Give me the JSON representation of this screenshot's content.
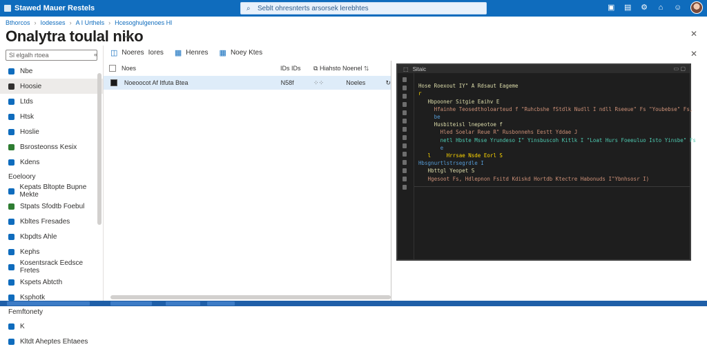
{
  "topbar": {
    "title": "Stawed Mauer Restels",
    "search_text": "Seblt ohresnterts arsorsek lerebhtes",
    "icons": [
      "cloud-shell-icon",
      "notifications-icon",
      "settings-icon",
      "help-icon",
      "feedback-icon"
    ]
  },
  "breadcrumb": [
    "Bthorcos",
    "Iodesses",
    "A I Urthels",
    "Hcesoghulgenoes Hl"
  ],
  "page": {
    "title": "Onalytra toulal niko"
  },
  "leftnav": {
    "filter_placeholder": "Sl elgalh rtoea",
    "items": [
      {
        "label": "Nbe",
        "color": "#0f6cbd"
      },
      {
        "label": "Hoosie",
        "color": "#323130",
        "active": true
      },
      {
        "label": "Ltds",
        "color": "#0f6cbd"
      },
      {
        "label": "Htsk",
        "color": "#0f6cbd"
      },
      {
        "label": "Hoslie",
        "color": "#0f6cbd"
      },
      {
        "label": "Bsrosteonss Kesix",
        "color": "#2e7d32"
      },
      {
        "label": "Kdens",
        "color": "#0f6cbd"
      }
    ],
    "group1": "Eoeloory",
    "items2": [
      {
        "label": "Kepats Bltopte Bupne Mekte",
        "color": "#0f6cbd"
      },
      {
        "label": "Stpats Sfodtb Foebul",
        "color": "#2e7d32"
      },
      {
        "label": "Kbltes Fresades",
        "color": "#0f6cbd"
      },
      {
        "label": "Kbpdts Ahle",
        "color": "#0f6cbd"
      },
      {
        "label": "Kephs",
        "color": "#0f6cbd"
      },
      {
        "label": "Kosentsrack Eedsce Fretes",
        "color": "#0f6cbd"
      },
      {
        "label": "Kspets Abtcth",
        "color": "#0f6cbd"
      },
      {
        "label": "Ksphotk",
        "color": "#0f6cbd"
      }
    ],
    "group2": "Femftonety",
    "items3": [
      {
        "label": "K",
        "color": "#0f6cbd"
      },
      {
        "label": "Kltdt Aheptes Ehtaees",
        "color": "#0f6cbd"
      }
    ]
  },
  "toolbar": {
    "new_label": "Noeres",
    "refresh_label": "Iores",
    "refresh2_label": "Henres",
    "open_label": "Noey Ktes"
  },
  "querylist": {
    "header": {
      "name": "Noes",
      "c2": "IDs",
      "c3": "IDs",
      "c4": "Hiahsto",
      "c5": "Noenel"
    },
    "row": {
      "name": "Noeoocot Af Itfuta Btea",
      "c2": "N58f",
      "c3": "⁘⁘",
      "c4": "Noeles"
    }
  },
  "editor": {
    "title": "Sitaic",
    "lines": [
      "Hose Roexout IY\" A Rdsaut Eageme",
      "r",
      "",
      "   Hbpooner Sitgie Eaihv E",
      "     Hfainhe Teosedtholoarteud f \"Ruhcbshe fStdlk Nudll I ndll Rseeue\" Fs \"Youbebse\" Fs,",
      "     be",
      "     Husbiteisl lnepeotoe f",
      "       Hled Soelar Reue R\" Rusbonnehs Eestt Yddae J",
      "       netl Hbste Msse Yrundeso I\" Yinsbuscoh Kitlk I \"Loat Hurs Foeeuluo Isto Yinsbe\" Fs",
      "       e",
      "   l     Hrrsae Nsde Eorl S",
      "",
      "",
      "Hbsgnurtlstrsegrdle I",
      "   Hbttgl Yeopet S",
      "   Hgesoot Fs, Hdlepnon Fsitd Kdiskd Hortdb Ktectre Habonuds I\"Ybnhsosr I)"
    ]
  }
}
